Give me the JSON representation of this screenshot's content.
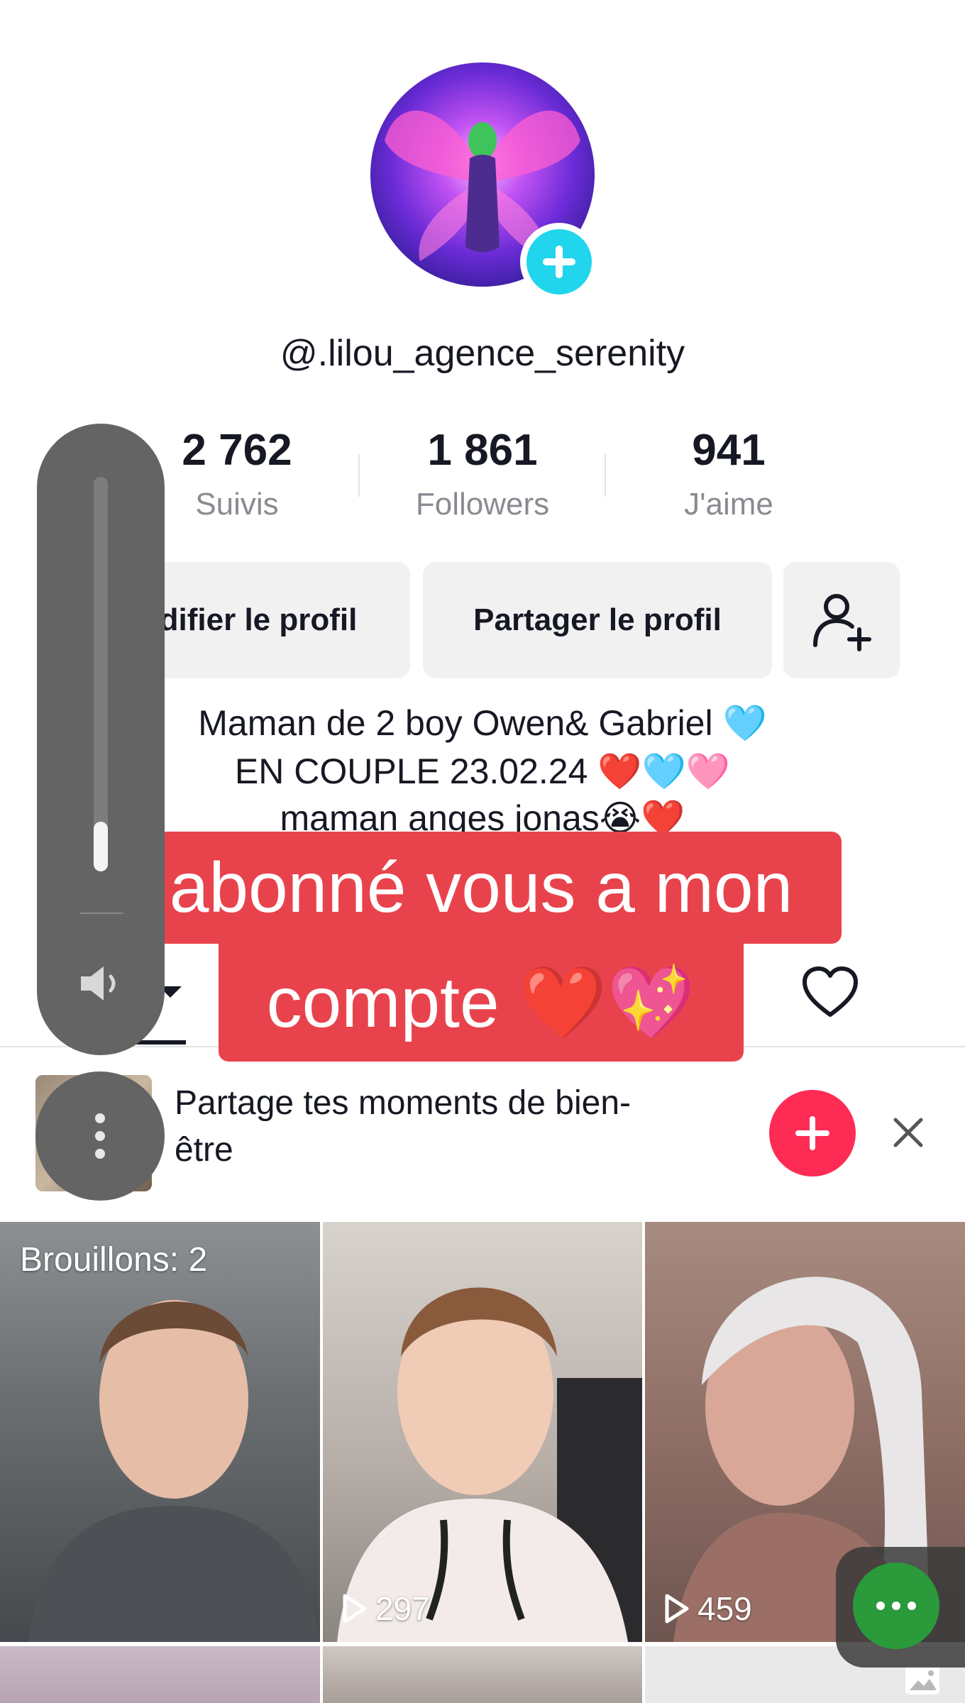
{
  "profile": {
    "username": "@.lilou_agence_serenity"
  },
  "stats": [
    {
      "value": "2 762",
      "label": "Suivis"
    },
    {
      "value": "1 861",
      "label": "Followers"
    },
    {
      "value": "941",
      "label": "J'aime"
    }
  ],
  "buttons": {
    "edit_label": "difier le profil",
    "share_label": "Partager le profil"
  },
  "bio": [
    "Maman de 2 boy Owen& Gabriel 🩵",
    "EN COUPLE 23.02.24 ❤️🩵🩷",
    "maman anges jonas😭❤️"
  ],
  "caption": {
    "line1": "abonné vous a mon",
    "line2": "compte ❤️💖"
  },
  "share_banner": {
    "text": "Partage tes moments de bien-être"
  },
  "grid": {
    "drafts_label": "Brouillons: 2",
    "items": [
      {
        "views": "297"
      },
      {
        "views": "459"
      }
    ]
  },
  "colors": {
    "accent_red": "#fe2c55",
    "caption_bg": "#e8434c",
    "add_cyan": "#20d5ec",
    "fab_green": "#2b9a3a"
  },
  "volume": {
    "level_percent": 13
  }
}
